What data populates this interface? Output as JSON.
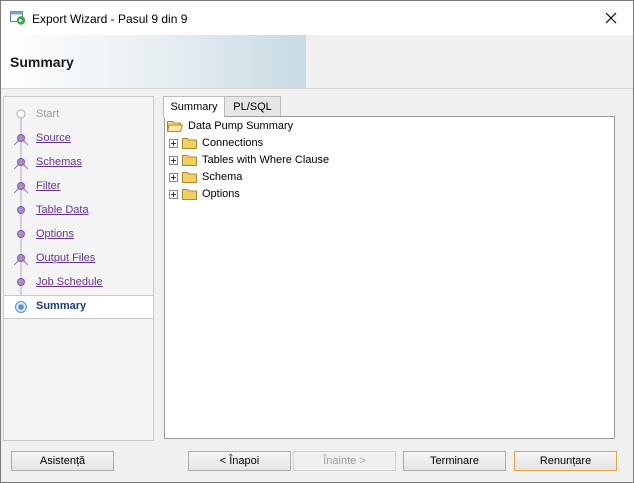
{
  "window": {
    "title": "Export Wizard - Pasul 9 din 9"
  },
  "header": {
    "title": "Summary"
  },
  "steps": [
    {
      "label": "Start",
      "state": "disabled"
    },
    {
      "label": "Source",
      "state": "link"
    },
    {
      "label": "Schemas",
      "state": "link"
    },
    {
      "label": "Filter",
      "state": "link"
    },
    {
      "label": "Table Data",
      "state": "link"
    },
    {
      "label": "Options",
      "state": "link"
    },
    {
      "label": "Output Files",
      "state": "link"
    },
    {
      "label": "Job Schedule",
      "state": "link"
    },
    {
      "label": "Summary",
      "state": "active"
    }
  ],
  "tabs": [
    {
      "label": "Summary",
      "selected": true
    },
    {
      "label": "PL/SQL",
      "selected": false
    }
  ],
  "tree": {
    "root": "Data Pump Summary",
    "children": [
      "Connections",
      "Tables with Where Clause",
      "Schema",
      "Options"
    ]
  },
  "buttons": {
    "help": "Asistență",
    "back": "< Înapoi",
    "next": "Înainte >",
    "finish": "Terminare",
    "cancel": "Renunțare"
  },
  "icons": {
    "app": "export-wizard-icon",
    "close": "close-icon",
    "folder": "folder-icon",
    "open_folder": "open-folder-icon"
  },
  "colors": {
    "link": "#663399",
    "active_step": "#1e3c7a",
    "default_button_border": "#e5a34b"
  }
}
